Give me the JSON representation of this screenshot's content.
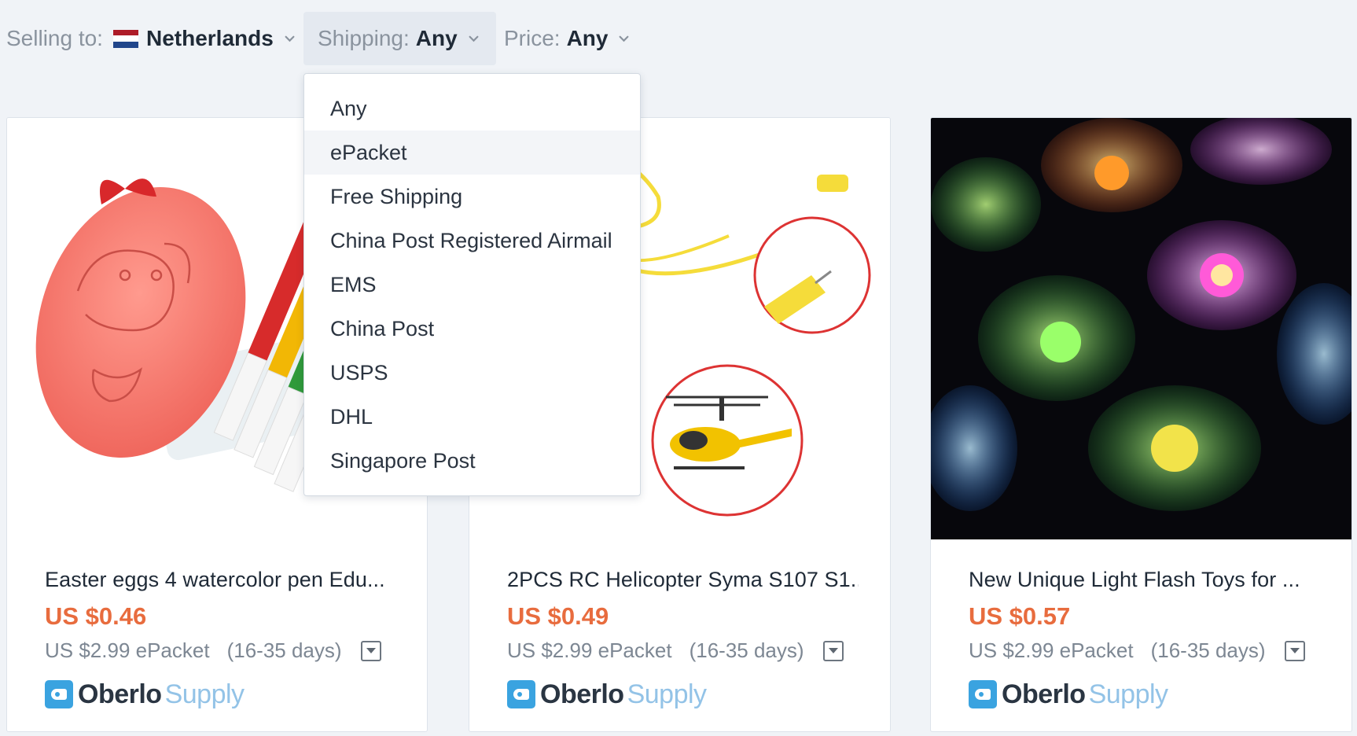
{
  "filters": {
    "country": {
      "label": "Selling to:",
      "value": "Netherlands",
      "flag_colors": [
        "#ae1c28",
        "#ffffff",
        "#21468b"
      ]
    },
    "shipping": {
      "label": "Shipping:",
      "value": "Any"
    },
    "price": {
      "label": "Price:",
      "value": "Any"
    }
  },
  "shipping_dropdown": {
    "highlighted": "ePacket",
    "options": [
      "Any",
      "ePacket",
      "Free Shipping",
      "China Post Registered Airmail",
      "EMS",
      "China Post",
      "USPS",
      "DHL",
      "Singapore Post"
    ]
  },
  "products": [
    {
      "title": "Easter eggs 4 watercolor pen Edu...",
      "price": "US $0.46",
      "shipping": "US $2.99 ePacket",
      "days": "(16-35 days)",
      "image": "easter-egg-markers"
    },
    {
      "title": "2PCS RC Helicopter Syma S107 S1...",
      "price": "US $0.49",
      "shipping": "US $2.99 ePacket",
      "days": "(16-35 days)",
      "image": "helicopter-cable"
    },
    {
      "title": "New Unique Light Flash Toys for ...",
      "price": "US $0.57",
      "shipping": "US $2.99 ePacket",
      "days": "(16-35 days)",
      "image": "led-bracelets"
    }
  ],
  "brand": {
    "part1": "Oberlo",
    "part2": "Supply"
  },
  "colors": {
    "accent_price": "#e86c3e",
    "brand_blue": "#3aa3e0",
    "background": "#f0f3f7"
  }
}
